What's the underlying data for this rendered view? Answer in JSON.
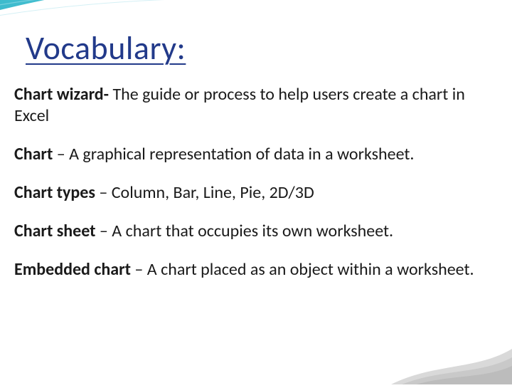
{
  "title": "Vocabulary:",
  "entries": [
    {
      "term": "Chart wizard-",
      "def": " The guide or process to help users create a chart in Excel"
    },
    {
      "term": "Chart",
      "def": " – A graphical representation of data in a worksheet."
    },
    {
      "term": "Chart types",
      "def": " – Column, Bar, Line, Pie, 2D/3D"
    },
    {
      "term": "Chart sheet",
      "def": " – A chart that occupies its own worksheet."
    },
    {
      "term": "Embedded chart",
      "def": " – A chart placed as an object within a worksheet."
    }
  ],
  "iconNames": {
    "swoosh": "wave-swoosh-icon",
    "corner": "corner-accent-icon"
  }
}
